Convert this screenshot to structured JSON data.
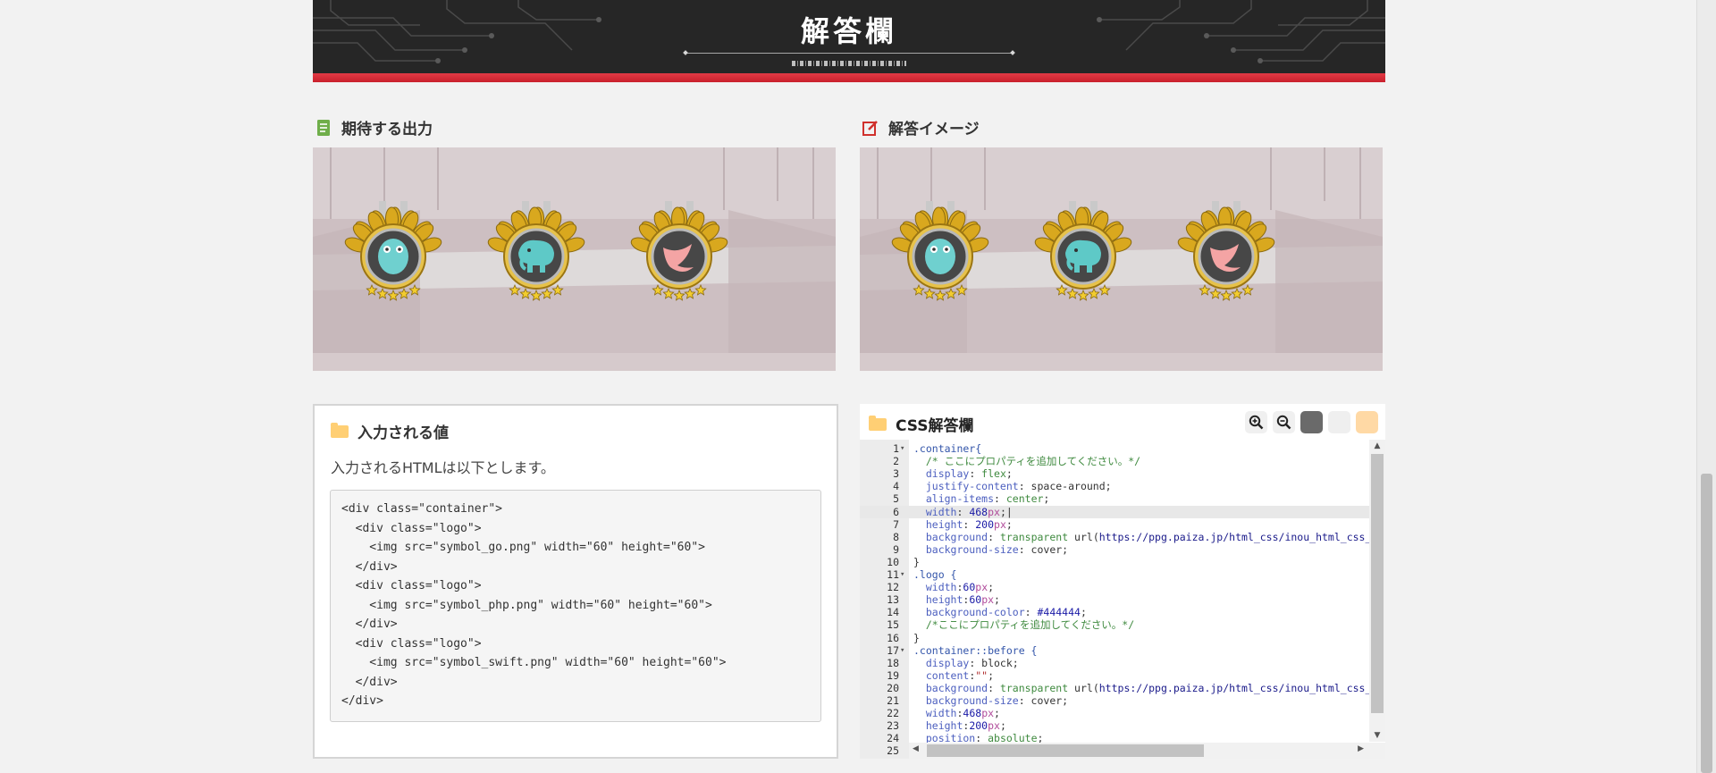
{
  "banner": {
    "title": "解答欄"
  },
  "expected": {
    "title": "期待する出力"
  },
  "answer_image": {
    "title": "解答イメージ"
  },
  "input_section": {
    "title": "入力される値",
    "description": "入力されるHTMLは以下とします。",
    "code_lines": [
      "<div class=\"container\">",
      "  <div class=\"logo\">",
      "    <img src=\"symbol_go.png\" width=\"60\" height=\"60\">",
      "  </div>",
      "  <div class=\"logo\">",
      "    <img src=\"symbol_php.png\" width=\"60\" height=\"60\">",
      "  </div>",
      "  <div class=\"logo\">",
      "    <img src=\"symbol_swift.png\" width=\"60\" height=\"60\">",
      "  </div>",
      "</div>"
    ]
  },
  "css_editor": {
    "title": "CSS解答欄",
    "tools": {
      "zoom_in": "zoom-in-icon",
      "zoom_out": "zoom-out-icon",
      "theme_dark": "#6a6a6a",
      "theme_light": "#efefef",
      "theme_warm": "#ffd9a5"
    },
    "active_line": 6,
    "lines": [
      {
        "n": "1",
        "fold": "▾",
        "tokens": [
          [
            ".container{",
            "#3355aa"
          ]
        ]
      },
      {
        "n": "2",
        "fold": "",
        "tokens": [
          [
            "  /* ここにプロパティを追加してください。*/",
            "#3f8a3f"
          ]
        ]
      },
      {
        "n": "3",
        "fold": "",
        "tokens": [
          [
            "  display",
            "#4c5fbf"
          ],
          [
            ": ",
            "#333"
          ],
          [
            "flex",
            "#3f8a3f"
          ],
          [
            ";",
            "#333"
          ]
        ]
      },
      {
        "n": "4",
        "fold": "",
        "tokens": [
          [
            "  justify-content",
            "#4c5fbf"
          ],
          [
            ": space-around;",
            "#333"
          ]
        ]
      },
      {
        "n": "5",
        "fold": "",
        "tokens": [
          [
            "  align-items",
            "#4c5fbf"
          ],
          [
            ": ",
            "#333"
          ],
          [
            "center",
            "#3f8a3f"
          ],
          [
            ";",
            "#333"
          ]
        ]
      },
      {
        "n": "6",
        "fold": "",
        "tokens": [
          [
            "  width",
            "#4c5fbf"
          ],
          [
            ": ",
            "#333"
          ],
          [
            "468",
            "#1a1aa6"
          ],
          [
            "px",
            "#b04a9a"
          ],
          [
            ";|",
            "#333"
          ]
        ]
      },
      {
        "n": "7",
        "fold": "",
        "tokens": [
          [
            "  height",
            "#4c5fbf"
          ],
          [
            ": ",
            "#333"
          ],
          [
            "200",
            "#1a1aa6"
          ],
          [
            "px",
            "#b04a9a"
          ],
          [
            ";",
            "#333"
          ]
        ]
      },
      {
        "n": "8",
        "fold": "",
        "tokens": [
          [
            "  background",
            "#4c5fbf"
          ],
          [
            ": ",
            "#333"
          ],
          [
            "transparent",
            "#3f8a3f"
          ],
          [
            " url(",
            "#333"
          ],
          [
            "https://ppg.paiza.jp/html_css/inou_html_css_",
            "#1a1a8a"
          ]
        ]
      },
      {
        "n": "9",
        "fold": "",
        "tokens": [
          [
            "  background-size",
            "#4c5fbf"
          ],
          [
            ": cover;",
            "#333"
          ]
        ]
      },
      {
        "n": "10",
        "fold": "",
        "tokens": [
          [
            "}",
            "#333"
          ]
        ]
      },
      {
        "n": "11",
        "fold": "▾",
        "tokens": [
          [
            ".logo {",
            "#3355aa"
          ]
        ]
      },
      {
        "n": "12",
        "fold": "",
        "tokens": [
          [
            "  width",
            "#4c5fbf"
          ],
          [
            ":",
            "#333"
          ],
          [
            "60",
            "#1a1aa6"
          ],
          [
            "px",
            "#b04a9a"
          ],
          [
            ";",
            "#333"
          ]
        ]
      },
      {
        "n": "13",
        "fold": "",
        "tokens": [
          [
            "  height",
            "#4c5fbf"
          ],
          [
            ":",
            "#333"
          ],
          [
            "60",
            "#1a1aa6"
          ],
          [
            "px",
            "#b04a9a"
          ],
          [
            ";",
            "#333"
          ]
        ]
      },
      {
        "n": "14",
        "fold": "",
        "tokens": [
          [
            "  background-color",
            "#4c5fbf"
          ],
          [
            ": ",
            "#333"
          ],
          [
            "#444444",
            "#1a1aa6"
          ],
          [
            ";",
            "#333"
          ]
        ]
      },
      {
        "n": "15",
        "fold": "",
        "tokens": [
          [
            "  /*ここにプロパティを追加してください。*/",
            "#3f8a3f"
          ]
        ]
      },
      {
        "n": "16",
        "fold": "",
        "tokens": [
          [
            "}",
            "#333"
          ]
        ]
      },
      {
        "n": "17",
        "fold": "▾",
        "tokens": [
          [
            ".container::before {",
            "#3355aa"
          ]
        ]
      },
      {
        "n": "18",
        "fold": "",
        "tokens": [
          [
            "  display",
            "#4c5fbf"
          ],
          [
            ": block;",
            "#333"
          ]
        ]
      },
      {
        "n": "19",
        "fold": "",
        "tokens": [
          [
            "  content",
            "#4c5fbf"
          ],
          [
            ":",
            "#333"
          ],
          [
            "\"\"",
            "#b03030"
          ],
          [
            ";",
            "#333"
          ]
        ]
      },
      {
        "n": "20",
        "fold": "",
        "tokens": [
          [
            "  background",
            "#4c5fbf"
          ],
          [
            ": ",
            "#333"
          ],
          [
            "transparent",
            "#3f8a3f"
          ],
          [
            " url(",
            "#333"
          ],
          [
            "https://ppg.paiza.jp/html_css/inou_html_css_",
            "#1a1a8a"
          ]
        ]
      },
      {
        "n": "21",
        "fold": "",
        "tokens": [
          [
            "  background-size",
            "#4c5fbf"
          ],
          [
            ": cover;",
            "#333"
          ]
        ]
      },
      {
        "n": "22",
        "fold": "",
        "tokens": [
          [
            "  width",
            "#4c5fbf"
          ],
          [
            ":",
            "#333"
          ],
          [
            "468",
            "#1a1aa6"
          ],
          [
            "px",
            "#b04a9a"
          ],
          [
            ";",
            "#333"
          ]
        ]
      },
      {
        "n": "23",
        "fold": "",
        "tokens": [
          [
            "  height",
            "#4c5fbf"
          ],
          [
            ":",
            "#333"
          ],
          [
            "200",
            "#1a1aa6"
          ],
          [
            "px",
            "#b04a9a"
          ],
          [
            ";",
            "#333"
          ]
        ]
      },
      {
        "n": "24",
        "fold": "",
        "tokens": [
          [
            "  position",
            "#4c5fbf"
          ],
          [
            ": ",
            "#333"
          ],
          [
            "absolute",
            "#3f8a3f"
          ],
          [
            ";",
            "#333"
          ]
        ]
      },
      {
        "n": "25",
        "fold": "",
        "tokens": []
      }
    ]
  },
  "badges": [
    {
      "name": "go",
      "icon": "gopher-icon",
      "color": "#6fd0cf"
    },
    {
      "name": "php",
      "icon": "elephant-icon",
      "color": "#5ec9c7"
    },
    {
      "name": "swift",
      "icon": "swift-bird-icon",
      "color": "#f4a4a4"
    }
  ]
}
